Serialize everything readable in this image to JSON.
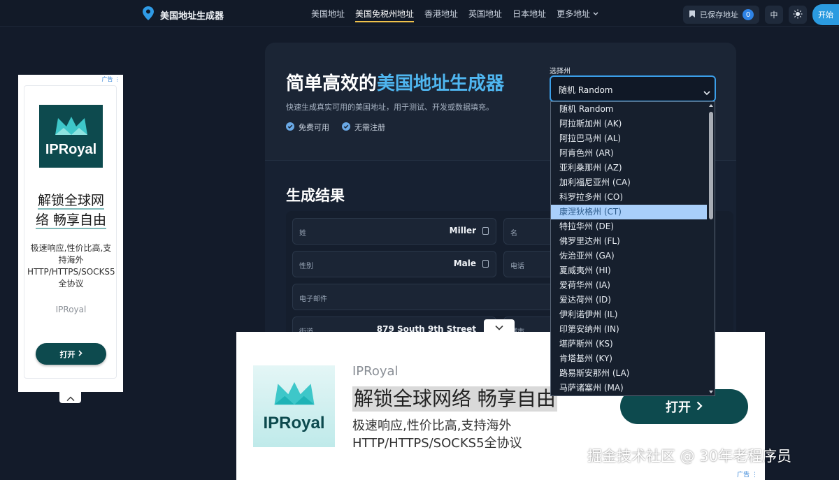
{
  "nav": {
    "brand": "美国地址生成器",
    "links": [
      "美国地址",
      "美国免税州地址",
      "香港地址",
      "英国地址",
      "日本地址",
      "更多地址"
    ],
    "saved_label": "已保存地址",
    "saved_count": "0",
    "lang": "中",
    "start_label": "开始"
  },
  "hero": {
    "title_prefix": "简单高效的",
    "title_highlight": "美国地址生成器",
    "subtitle": "快速生成真实可用的美国地址，用于测试、开发或数据填充。",
    "badges": [
      "免费可用",
      "无需注册"
    ]
  },
  "state_select": {
    "label": "选择州",
    "value": "随机 Random",
    "options": [
      "随机 Random",
      "阿拉斯加州 (AK)",
      "阿拉巴马州 (AL)",
      "阿肯色州 (AR)",
      "亚利桑那州 (AZ)",
      "加利福尼亚州 (CA)",
      "科罗拉多州 (CO)",
      "康涅狄格州 (CT)",
      "特拉华州 (DE)",
      "佛罗里达州 (FL)",
      "佐治亚州 (GA)",
      "夏威夷州 (HI)",
      "爱荷华州 (IA)",
      "爱达荷州 (ID)",
      "伊利诺伊州 (IL)",
      "印第安纳州 (IN)",
      "堪萨斯州 (KS)",
      "肯塔基州 (KY)",
      "路易斯安那州 (LA)",
      "马萨诸塞州 (MA)"
    ],
    "highlighted": "康涅狄格州 (CT)"
  },
  "results": {
    "title": "生成结果",
    "fields": {
      "last_name": {
        "label": "姓",
        "value": "Miller"
      },
      "first_name": {
        "label": "名",
        "value": ""
      },
      "gender": {
        "label": "性别",
        "value": "Male"
      },
      "phone": {
        "label": "电话",
        "value": ""
      },
      "email": {
        "label": "电子邮件",
        "value": ""
      },
      "street": {
        "label": "街道",
        "value": "879 South 9th Street"
      },
      "city": {
        "label": "城市",
        "value": ""
      }
    }
  },
  "left_ad": {
    "label": "广告",
    "logo": "IPRoyal",
    "headline_1": "解锁全球网",
    "headline_2": "络 畅享自由",
    "description": "极速响应,性价比高,支持海外HTTP/HTTPS/SOCKS5全协议",
    "brand": "IPRoyal",
    "button": "打开"
  },
  "bottom_ad": {
    "label": "广告",
    "logo": "IPRoyal",
    "brand": "IPRoyal",
    "headline": "解锁全球网络 畅享自由",
    "description": "极速响应,性价比高,支持海外HTTP/HTTPS/SOCKS5全协议",
    "button": "打开"
  },
  "watermark": "掘金技术社区 @ 30年老程序员"
}
